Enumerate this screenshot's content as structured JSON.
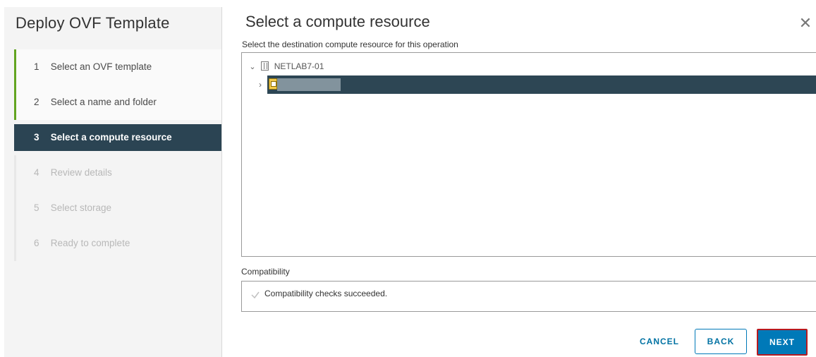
{
  "wizard": {
    "title": "Deploy OVF Template",
    "steps": [
      {
        "number": "1",
        "label": "Select an OVF template",
        "state": "done"
      },
      {
        "number": "2",
        "label": "Select a name and folder",
        "state": "done"
      },
      {
        "number": "3",
        "label": "Select a compute resource",
        "state": "current"
      },
      {
        "number": "4",
        "label": "Review details",
        "state": "future"
      },
      {
        "number": "5",
        "label": "Select storage",
        "state": "future"
      },
      {
        "number": "6",
        "label": "Ready to complete",
        "state": "future"
      }
    ]
  },
  "page": {
    "title": "Select a compute resource",
    "close_icon": "close-icon",
    "subtitle": "Select the destination compute resource for this operation"
  },
  "tree": {
    "root": {
      "label": "NETLAB7-01",
      "icon": "datacenter-icon",
      "expanded": true
    },
    "child": {
      "label": "",
      "icon": "host-icon",
      "selected": true,
      "expanded": false
    }
  },
  "compatibility": {
    "label": "Compatibility",
    "message": "Compatibility checks succeeded."
  },
  "buttons": {
    "cancel": "CANCEL",
    "back": "BACK",
    "next": "NEXT"
  },
  "colors": {
    "selected_bg": "#2b4453",
    "done_accent": "#62a420",
    "primary": "#0079b8",
    "highlight_border": "#b8191f"
  }
}
